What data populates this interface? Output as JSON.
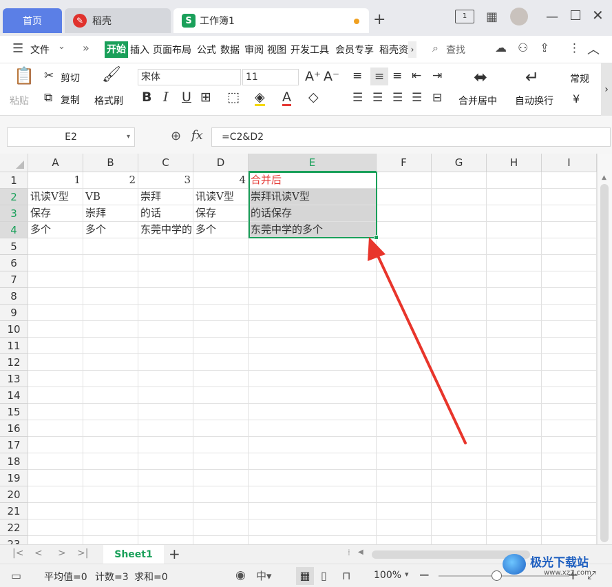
{
  "tabs": {
    "home": "首页",
    "daoke": "稻壳",
    "workbook": "工作簿1",
    "new_tab": "+"
  },
  "menu": {
    "file": "文件",
    "items": [
      "开始",
      "插入",
      "页面布局",
      "公式",
      "数据",
      "审阅",
      "视图",
      "开发工具",
      "会员专享",
      "稻壳资"
    ],
    "search": "查找"
  },
  "ribbon": {
    "paste": "粘贴",
    "cut": "剪切",
    "copy": "复制",
    "format_painter": "格式刷",
    "font_name": "宋体",
    "font_size": "11",
    "merge_center": "合并居中",
    "wrap_text": "自动换行",
    "number_format": "常规",
    "currency": "¥"
  },
  "formula_bar": {
    "name_box": "E2",
    "fx": "fx",
    "formula": "=C2&D2"
  },
  "grid": {
    "columns": [
      "A",
      "B",
      "C",
      "D",
      "E",
      "F",
      "G",
      "H",
      "I"
    ],
    "rows": [
      "1",
      "2",
      "3",
      "4",
      "5",
      "6",
      "7",
      "8",
      "9",
      "10",
      "11",
      "12",
      "13",
      "14",
      "15",
      "16",
      "17",
      "18",
      "19",
      "20",
      "21",
      "22",
      "23"
    ],
    "cells": {
      "A1": "1",
      "B1": "2",
      "C1": "3",
      "D1": "4",
      "E1": "合并后",
      "A2": "讯读V型",
      "B2": "VB",
      "C2": "崇拜",
      "D2": "讯读V型",
      "E2": "崇拜讯读V型",
      "A3": "保存",
      "B3": "崇拜",
      "C3": "的话",
      "D3": "保存",
      "E3": "的话保存",
      "A4": "多个",
      "B4": "多个",
      "C4": "东莞中学的",
      "D4": "多个",
      "E4": "东莞中学的多个"
    },
    "selected_range": "E2:E4",
    "header_color": "#e53935",
    "selection_color": "#1aa05a"
  },
  "sheets": {
    "active": "Sheet1",
    "add": "+"
  },
  "status": {
    "average": "平均值=0",
    "count": "计数=3",
    "sum": "求和=0",
    "zoom": "100%"
  },
  "watermark": {
    "text": "极光下载站",
    "url": "www.xz7.com"
  },
  "annotation": {
    "type": "arrow",
    "color": "#e8352b"
  }
}
